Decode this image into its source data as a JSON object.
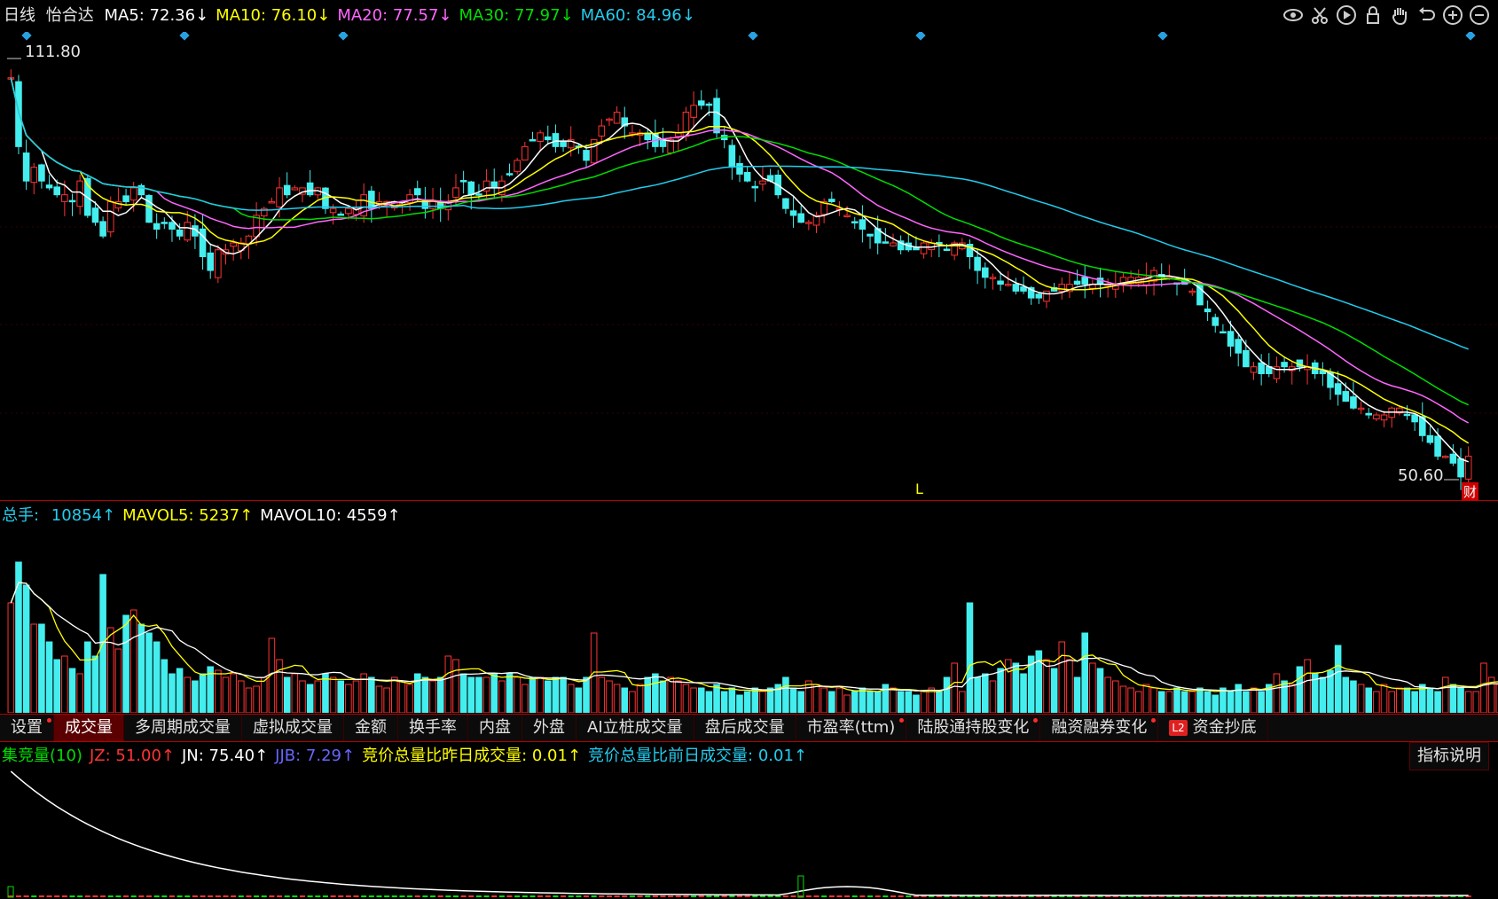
{
  "header": {
    "period": "日线",
    "stock_name": "怡合达",
    "ma_legend": [
      {
        "label": "MA5: 72.36",
        "arrow": "↓",
        "color": "#ffffff"
      },
      {
        "label": "MA10: 76.10",
        "arrow": "↓",
        "color": "#ffff00"
      },
      {
        "label": "MA20: 77.57",
        "arrow": "↓",
        "color": "#ff66ff"
      },
      {
        "label": "MA30: 77.97",
        "arrow": "↓",
        "color": "#00dd00"
      },
      {
        "label": "MA60: 84.96",
        "arrow": "↓",
        "color": "#22ccee"
      }
    ],
    "toolbar_icons": [
      "eye-icon",
      "scissors-icon",
      "play-icon",
      "lock-icon",
      "hand-icon",
      "undo-icon",
      "zoom-in-icon",
      "zoom-out-icon"
    ]
  },
  "price_panel": {
    "high_label": "111.80",
    "low_label": "50.60",
    "marker_L": "L",
    "marker_cai": "财"
  },
  "volume_panel": {
    "legend": [
      {
        "label": "总手: ",
        "color": "#22ccee"
      },
      {
        "label": "10854",
        "arrow": "↑",
        "color": "#22ccee"
      },
      {
        "label": "MAVOL5: 5237",
        "arrow": "↑",
        "color": "#ffff00"
      },
      {
        "label": "MAVOL10: 4559",
        "arrow": "↑",
        "color": "#ffffff"
      }
    ]
  },
  "tabs": [
    {
      "label": "设置",
      "active": false,
      "dot": true
    },
    {
      "label": "成交量",
      "active": true,
      "dot": false
    },
    {
      "label": "多周期成交量",
      "active": false,
      "dot": false
    },
    {
      "label": "虚拟成交量",
      "active": false,
      "dot": false
    },
    {
      "label": "金额",
      "active": false,
      "dot": false
    },
    {
      "label": "换手率",
      "active": false,
      "dot": false
    },
    {
      "label": "内盘",
      "active": false,
      "dot": false
    },
    {
      "label": "外盘",
      "active": false,
      "dot": false
    },
    {
      "label": "AI立桩成交量",
      "active": false,
      "dot": false
    },
    {
      "label": "盘后成交量",
      "active": false,
      "dot": false
    },
    {
      "label": "市盈率(ttm)",
      "active": false,
      "dot": true
    },
    {
      "label": "陆股通持股变化",
      "active": false,
      "dot": true
    },
    {
      "label": "融资融券变化",
      "active": false,
      "dot": true
    },
    {
      "label": "资金抄底",
      "active": false,
      "dot": false,
      "badge": "L2"
    }
  ],
  "auction_panel": {
    "legend": [
      {
        "label": "集竞量(10)",
        "color": "#00dd00"
      },
      {
        "label": "JZ: 51.00",
        "arrow": "↑",
        "color": "#ff3333"
      },
      {
        "label": "JN: 75.40",
        "arrow": "↑",
        "color": "#ffffff"
      },
      {
        "label": "JJB: 7.29",
        "arrow": "↑",
        "color": "#6666ff"
      },
      {
        "label": "竞价总量比昨日成交量: 0.01",
        "arrow": "↑",
        "color": "#ffff00"
      },
      {
        "label": "竞价总量比前日成交量: 0.01",
        "arrow": "↑",
        "color": "#22ccee"
      }
    ],
    "help_button": "指标说明"
  },
  "colors": {
    "up": "#ff3333",
    "down": "#44eeee",
    "ma5": "#ffffff",
    "ma10": "#ffff00",
    "ma20": "#ff66ff",
    "ma30": "#00dd00",
    "ma60": "#22ccee"
  },
  "chart_data": [
    {
      "type": "candlestick",
      "title": "怡合达 日线",
      "ylim": [
        50.6,
        111.8
      ],
      "price_path": [
        109,
        99,
        94,
        96,
        94,
        93,
        92,
        92,
        91,
        94,
        89,
        88,
        86,
        91,
        91,
        91,
        93,
        92,
        88,
        87,
        88,
        87,
        86,
        88,
        86,
        83,
        81,
        84,
        84,
        85,
        85,
        86,
        89,
        90,
        91,
        93,
        92,
        93,
        93,
        92,
        93,
        90,
        90,
        89,
        90,
        90,
        92,
        90,
        91,
        91,
        91,
        91,
        92,
        92,
        90,
        91,
        90,
        91,
        93,
        94,
        92,
        92,
        94,
        93,
        94,
        95,
        97,
        99,
        100,
        101,
        100,
        99,
        99,
        100,
        99,
        97,
        100,
        102,
        103,
        104,
        102,
        101,
        101,
        100,
        99,
        99,
        100,
        101,
        104,
        105,
        105,
        105,
        101,
        100,
        96,
        95,
        94,
        93,
        94,
        94,
        92,
        90,
        89,
        88,
        88,
        89,
        91,
        91,
        90,
        89,
        88,
        87,
        86,
        85,
        85,
        85,
        84,
        84,
        84,
        85,
        85,
        85,
        84,
        85,
        85,
        83,
        81,
        80,
        80,
        79,
        79,
        78,
        78,
        77,
        77,
        78,
        78,
        79,
        79,
        79,
        79,
        79,
        79,
        79,
        79,
        80,
        80,
        80,
        80,
        81,
        80,
        80,
        79,
        79,
        78,
        76,
        75,
        73,
        72,
        70,
        69,
        67,
        67,
        66,
        66,
        67,
        67,
        67,
        67,
        67,
        66,
        66,
        64,
        63,
        62,
        61,
        61,
        60,
        60,
        60,
        61,
        61,
        60,
        59,
        57,
        56,
        54,
        54,
        53,
        51,
        54
      ]
    },
    {
      "type": "bar",
      "title": "成交量",
      "volume_profile": [
        0.62,
        0.85,
        0.72,
        0.5,
        0.5,
        0.4,
        0.3,
        0.32,
        0.25,
        0.22,
        0.4,
        0.32,
        0.78,
        0.48,
        0.36,
        0.55,
        0.58,
        0.5,
        0.45,
        0.4,
        0.3,
        0.22,
        0.25,
        0.2,
        0.18,
        0.22,
        0.26,
        0.24,
        0.2,
        0.22,
        0.18,
        0.14,
        0.15,
        0.2,
        0.42,
        0.3,
        0.2,
        0.22,
        0.18,
        0.16,
        0.18,
        0.22,
        0.2,
        0.18,
        0.16,
        0.18,
        0.22,
        0.2,
        0.15,
        0.14,
        0.2,
        0.18,
        0.16,
        0.22,
        0.2,
        0.18,
        0.2,
        0.32,
        0.3,
        0.22,
        0.2,
        0.2,
        0.2,
        0.22,
        0.18,
        0.22,
        0.2,
        0.16,
        0.2,
        0.2,
        0.18,
        0.2,
        0.2,
        0.16,
        0.14,
        0.2,
        0.45,
        0.2,
        0.18,
        0.16,
        0.14,
        0.12,
        0.16,
        0.2,
        0.22,
        0.18,
        0.2,
        0.18,
        0.16,
        0.14,
        0.14,
        0.12,
        0.16,
        0.12,
        0.14,
        0.1,
        0.12,
        0.14,
        0.12,
        0.14,
        0.16,
        0.2,
        0.14,
        0.12,
        0.18,
        0.16,
        0.14,
        0.12,
        0.14,
        0.1,
        0.12,
        0.14,
        0.12,
        0.12,
        0.16,
        0.14,
        0.12,
        0.12,
        0.1,
        0.12,
        0.14,
        0.12,
        0.2,
        0.28,
        0.12,
        0.62,
        0.2,
        0.22,
        0.18,
        0.25,
        0.3,
        0.28,
        0.22,
        0.32,
        0.35,
        0.3,
        0.25,
        0.4,
        0.3,
        0.2,
        0.45,
        0.28,
        0.25,
        0.2,
        0.18,
        0.15,
        0.14,
        0.12,
        0.16,
        0.14,
        0.12,
        0.12,
        0.14,
        0.12,
        0.12,
        0.14,
        0.12,
        0.1,
        0.14,
        0.12,
        0.16,
        0.12,
        0.14,
        0.12,
        0.16,
        0.22,
        0.18,
        0.16,
        0.26,
        0.3,
        0.22,
        0.2,
        0.24,
        0.38,
        0.2,
        0.18,
        0.16,
        0.14,
        0.12,
        0.16,
        0.12,
        0.14,
        0.14,
        0.12,
        0.16,
        0.14,
        0.12,
        0.2,
        0.16,
        0.14,
        0.12,
        0.12,
        0.28,
        0.2,
        0.16,
        0.14,
        0.12,
        0.1,
        0.16,
        0.22
      ],
      "y": {
        "总手": 10854,
        "MAVOL5": 5237,
        "MAVOL10": 4559
      }
    },
    {
      "type": "bar",
      "title": "集竞量(10)",
      "y": {
        "JZ": 51.0,
        "JN": 75.4,
        "JJB": 7.29,
        "竞价总量比昨日成交量": 0.01,
        "竞价总量比前日成交量": 0.01
      }
    }
  ]
}
